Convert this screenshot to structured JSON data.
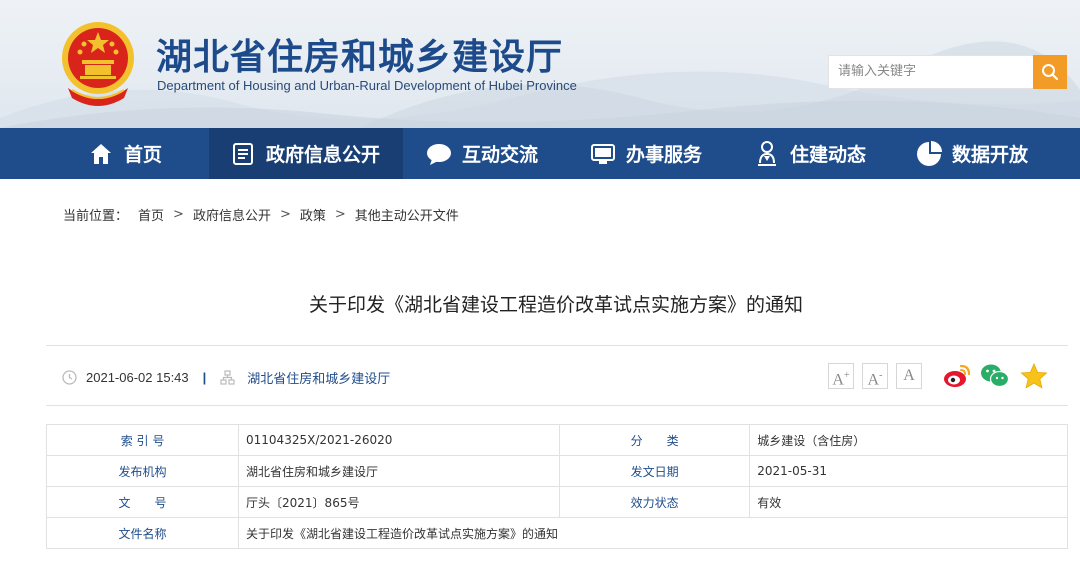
{
  "header": {
    "title": "湖北省住房和城乡建设厅",
    "subtitle": "Department of Housing and Urban-Rural Development of Hubei Province",
    "emblem_icon": "national-emblem-icon",
    "search": {
      "placeholder": "请输入关键字",
      "button_icon": "search-icon"
    }
  },
  "nav": {
    "items": [
      {
        "label": "首页",
        "icon": "home-icon",
        "active": false
      },
      {
        "label": "政府信息公开",
        "icon": "document-list-icon",
        "active": true
      },
      {
        "label": "互动交流",
        "icon": "chat-bubble-icon",
        "active": false
      },
      {
        "label": "办事服务",
        "icon": "monitor-icon",
        "active": false
      },
      {
        "label": "住建动态",
        "icon": "person-pin-icon",
        "active": false
      },
      {
        "label": "数据开放",
        "icon": "pie-chart-icon",
        "active": false
      }
    ]
  },
  "breadcrumb": {
    "prefix": "当前位置：",
    "items": [
      "首页",
      "政府信息公开",
      "政策",
      "其他主动公开文件"
    ],
    "separator": ">"
  },
  "article": {
    "title": "关于印发《湖北省建设工程造价改革试点实施方案》的通知",
    "datetime": "2021-06-02 15:43",
    "separator": "|",
    "source": "湖北省住房和城乡建设厅",
    "font_buttons": [
      {
        "label": "A",
        "sup": "+"
      },
      {
        "label": "A",
        "sup": "-"
      },
      {
        "label": "A",
        "sup": ""
      }
    ],
    "share_icons": [
      "weibo-icon",
      "wechat-icon",
      "favorite-star-icon"
    ]
  },
  "info_table": {
    "rows": [
      {
        "k1": "索 引 号",
        "v1": "01104325X/2021-26020",
        "k2": "分　　类",
        "v2": "城乡建设（含住房）"
      },
      {
        "k1": "发布机构",
        "v1": "湖北省住房和城乡建设厅",
        "k2": "发文日期",
        "v2": "2021-05-31"
      },
      {
        "k1": "文　　号",
        "v1": "厅头〔2021〕865号",
        "k2": "效力状态",
        "v2": "有效"
      }
    ],
    "file_name_label": "文件名称",
    "file_name": "关于印发《湖北省建设工程造价改革试点实施方案》的通知"
  },
  "colors": {
    "nav_bg": "#1f4d8c",
    "nav_active": "#183e74",
    "title_blue": "#1c4a8a",
    "search_orange": "#f29b26",
    "emblem_red": "#d9241c",
    "emblem_gold": "#f3c12d"
  }
}
